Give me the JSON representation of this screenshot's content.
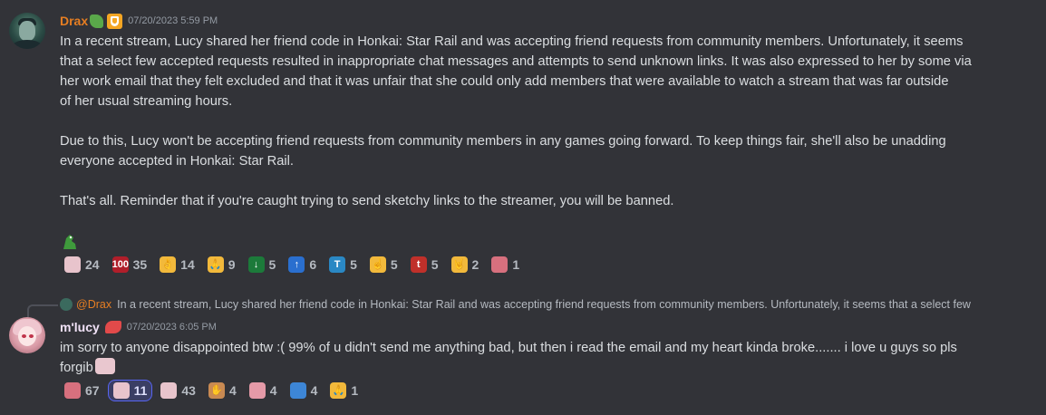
{
  "message1": {
    "author": "Drax",
    "timestamp": "07/20/2023 5:59 PM",
    "paragraphs": [
      [
        "In a recent stream, Lucy shared her friend code in Honkai: Star Rail and was accepting friend requests from community members. Unfortunately, it seems",
        "that a select few accepted requests resulted in inappropriate chat messages and attempts to send unknown links. It was also expressed to her by some via",
        "her work email that they felt excluded and that it was unfair that she could only add members that were available to watch a stream that was far outside",
        "of her usual streaming hours."
      ],
      [
        "Due to this, Lucy won't be accepting friend requests from community members in any games going forward. To keep things fair, she'll also be unadding",
        "everyone accepted in Honkai: Star Rail."
      ],
      [
        "That's all. Reminder that if you're caught trying to send sketchy links to the streamer, you will be banned."
      ]
    ],
    "reactions": [
      {
        "icon": "kitty-emoji",
        "count": "24",
        "color": "#e8c4cc",
        "glyph": "",
        "me": false
      },
      {
        "icon": "hundred-emoji",
        "count": "35",
        "color": "#b01e2a",
        "glyph": "100",
        "me": false
      },
      {
        "icon": "ok-hand-emoji",
        "count": "14",
        "color": "#f2b93b",
        "glyph": "👌",
        "me": false
      },
      {
        "icon": "pray-emoji",
        "count": "9",
        "color": "#f2b93b",
        "glyph": "🙏",
        "me": false
      },
      {
        "icon": "down-this-emoji",
        "count": "5",
        "color": "#1c7a3a",
        "glyph": "↓",
        "me": false
      },
      {
        "icon": "up-this-emoji",
        "count": "6",
        "color": "#2a6fcf",
        "glyph": "↑",
        "me": false
      },
      {
        "icon": "tnis-emoji",
        "count": "5",
        "color": "#2a88c4",
        "glyph": "T",
        "me": false
      },
      {
        "icon": "point-up-emoji",
        "count": "5",
        "color": "#f2b93b",
        "glyph": "☝",
        "me": false
      },
      {
        "icon": "this-tbh-emoji",
        "count": "5",
        "color": "#c0302a",
        "glyph": "t",
        "me": false
      },
      {
        "icon": "rock-on-emoji",
        "count": "2",
        "color": "#f2b93b",
        "glyph": "🤘",
        "me": false
      },
      {
        "icon": "heart-kitty-emoji",
        "count": "1",
        "color": "#d7707e",
        "glyph": "",
        "me": false
      }
    ]
  },
  "reply": {
    "mention": "@Drax",
    "preview": "In a recent stream, Lucy shared her friend code in Honkai: Star Rail and was accepting friend requests from community members. Unfortunately, it seems that a select few"
  },
  "message2": {
    "author": "m'lucy",
    "timestamp": "07/20/2023 6:05 PM",
    "lines": [
      "im sorry to anyone disappointed btw :( 99% of u didn't send me anything bad, but then i read the email and my heart kinda broke....... i love u guys so pls",
      "forgib"
    ],
    "reactions": [
      {
        "icon": "kitty-heart-emoji",
        "count": "67",
        "color": "#d7707e",
        "glyph": "",
        "me": false
      },
      {
        "icon": "cry-kitty-emoji",
        "count": "11",
        "color": "#e8c4cc",
        "glyph": "",
        "me": true
      },
      {
        "icon": "blush-kitty-emoji",
        "count": "43",
        "color": "#e8c4cc",
        "glyph": "",
        "me": false
      },
      {
        "icon": "hands-emoji",
        "count": "4",
        "color": "#c98a52",
        "glyph": "✋",
        "me": false
      },
      {
        "icon": "pink-kitty-emoji",
        "count": "4",
        "color": "#e59aa8",
        "glyph": "",
        "me": false
      },
      {
        "icon": "blue-hug-emoji",
        "count": "4",
        "color": "#3d86d6",
        "glyph": "",
        "me": false
      },
      {
        "icon": "pray-emoji",
        "count": "1",
        "color": "#f2b93b",
        "glyph": "🙏",
        "me": false
      }
    ]
  }
}
